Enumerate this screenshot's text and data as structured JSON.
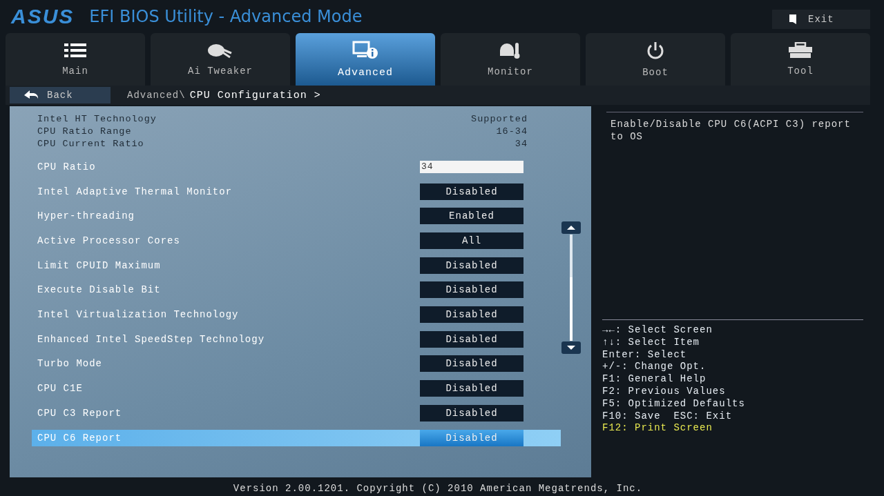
{
  "header": {
    "logo": "ASUS",
    "title": "EFI BIOS Utility - Advanced Mode",
    "exit_button": "Exit"
  },
  "tabs": [
    {
      "label": "Main",
      "selected": false
    },
    {
      "label": "Ai Tweaker",
      "selected": false
    },
    {
      "label": "Advanced",
      "selected": true
    },
    {
      "label": "Monitor",
      "selected": false
    },
    {
      "label": "Boot",
      "selected": false
    },
    {
      "label": "Tool",
      "selected": false
    }
  ],
  "breadcrumb": {
    "back_button": "Back",
    "parent": "Advanced\\",
    "current": "CPU Configuration >"
  },
  "info_rows": [
    {
      "label": "Intel HT Technology",
      "value": "Supported"
    },
    {
      "label": "CPU Ratio Range",
      "value": "16-34"
    },
    {
      "label": "CPU Current Ratio",
      "value": "34"
    }
  ],
  "settings": [
    {
      "label": "CPU Ratio",
      "kind": "input",
      "value": "34",
      "selected": false
    },
    {
      "label": "Intel Adaptive Thermal Monitor",
      "kind": "option",
      "value": "Disabled",
      "selected": false
    },
    {
      "label": "Hyper-threading",
      "kind": "option",
      "value": "Enabled",
      "selected": false
    },
    {
      "label": "Active Processor Cores",
      "kind": "option",
      "value": "All",
      "selected": false
    },
    {
      "label": "Limit CPUID Maximum",
      "kind": "option",
      "value": "Disabled",
      "selected": false
    },
    {
      "label": "Execute Disable Bit",
      "kind": "option",
      "value": "Disabled",
      "selected": false
    },
    {
      "label": "Intel Virtualization Technology",
      "kind": "option",
      "value": "Disabled",
      "selected": false
    },
    {
      "label": "Enhanced Intel SpeedStep Technology",
      "kind": "option",
      "value": "Disabled",
      "selected": false
    },
    {
      "label": "Turbo Mode",
      "kind": "option",
      "value": "Disabled",
      "selected": false
    },
    {
      "label": "CPU C1E",
      "kind": "option",
      "value": "Disabled",
      "selected": false
    },
    {
      "label": "CPU C3 Report",
      "kind": "option",
      "value": "Disabled",
      "selected": false
    },
    {
      "label": "CPU C6 Report",
      "kind": "option",
      "value": "Disabled",
      "selected": true
    }
  ],
  "help_text": "Enable/Disable CPU C6(ACPI C3) report to OS",
  "key_help": [
    {
      "text": "→←: Select Screen",
      "highlighted": false
    },
    {
      "text": "↑↓: Select Item",
      "highlighted": false
    },
    {
      "text": "Enter: Select",
      "highlighted": false
    },
    {
      "text": "+/-: Change Opt.",
      "highlighted": false
    },
    {
      "text": "F1: General Help",
      "highlighted": false
    },
    {
      "text": "F2: Previous Values",
      "highlighted": false
    },
    {
      "text": "F5: Optimized Defaults",
      "highlighted": false
    },
    {
      "text": "F10: Save  ESC: Exit",
      "highlighted": false
    },
    {
      "text": "F12: Print Screen",
      "highlighted": true
    }
  ],
  "footer": "Version 2.00.1201. Copyright (C) 2010 American Megatrends, Inc."
}
